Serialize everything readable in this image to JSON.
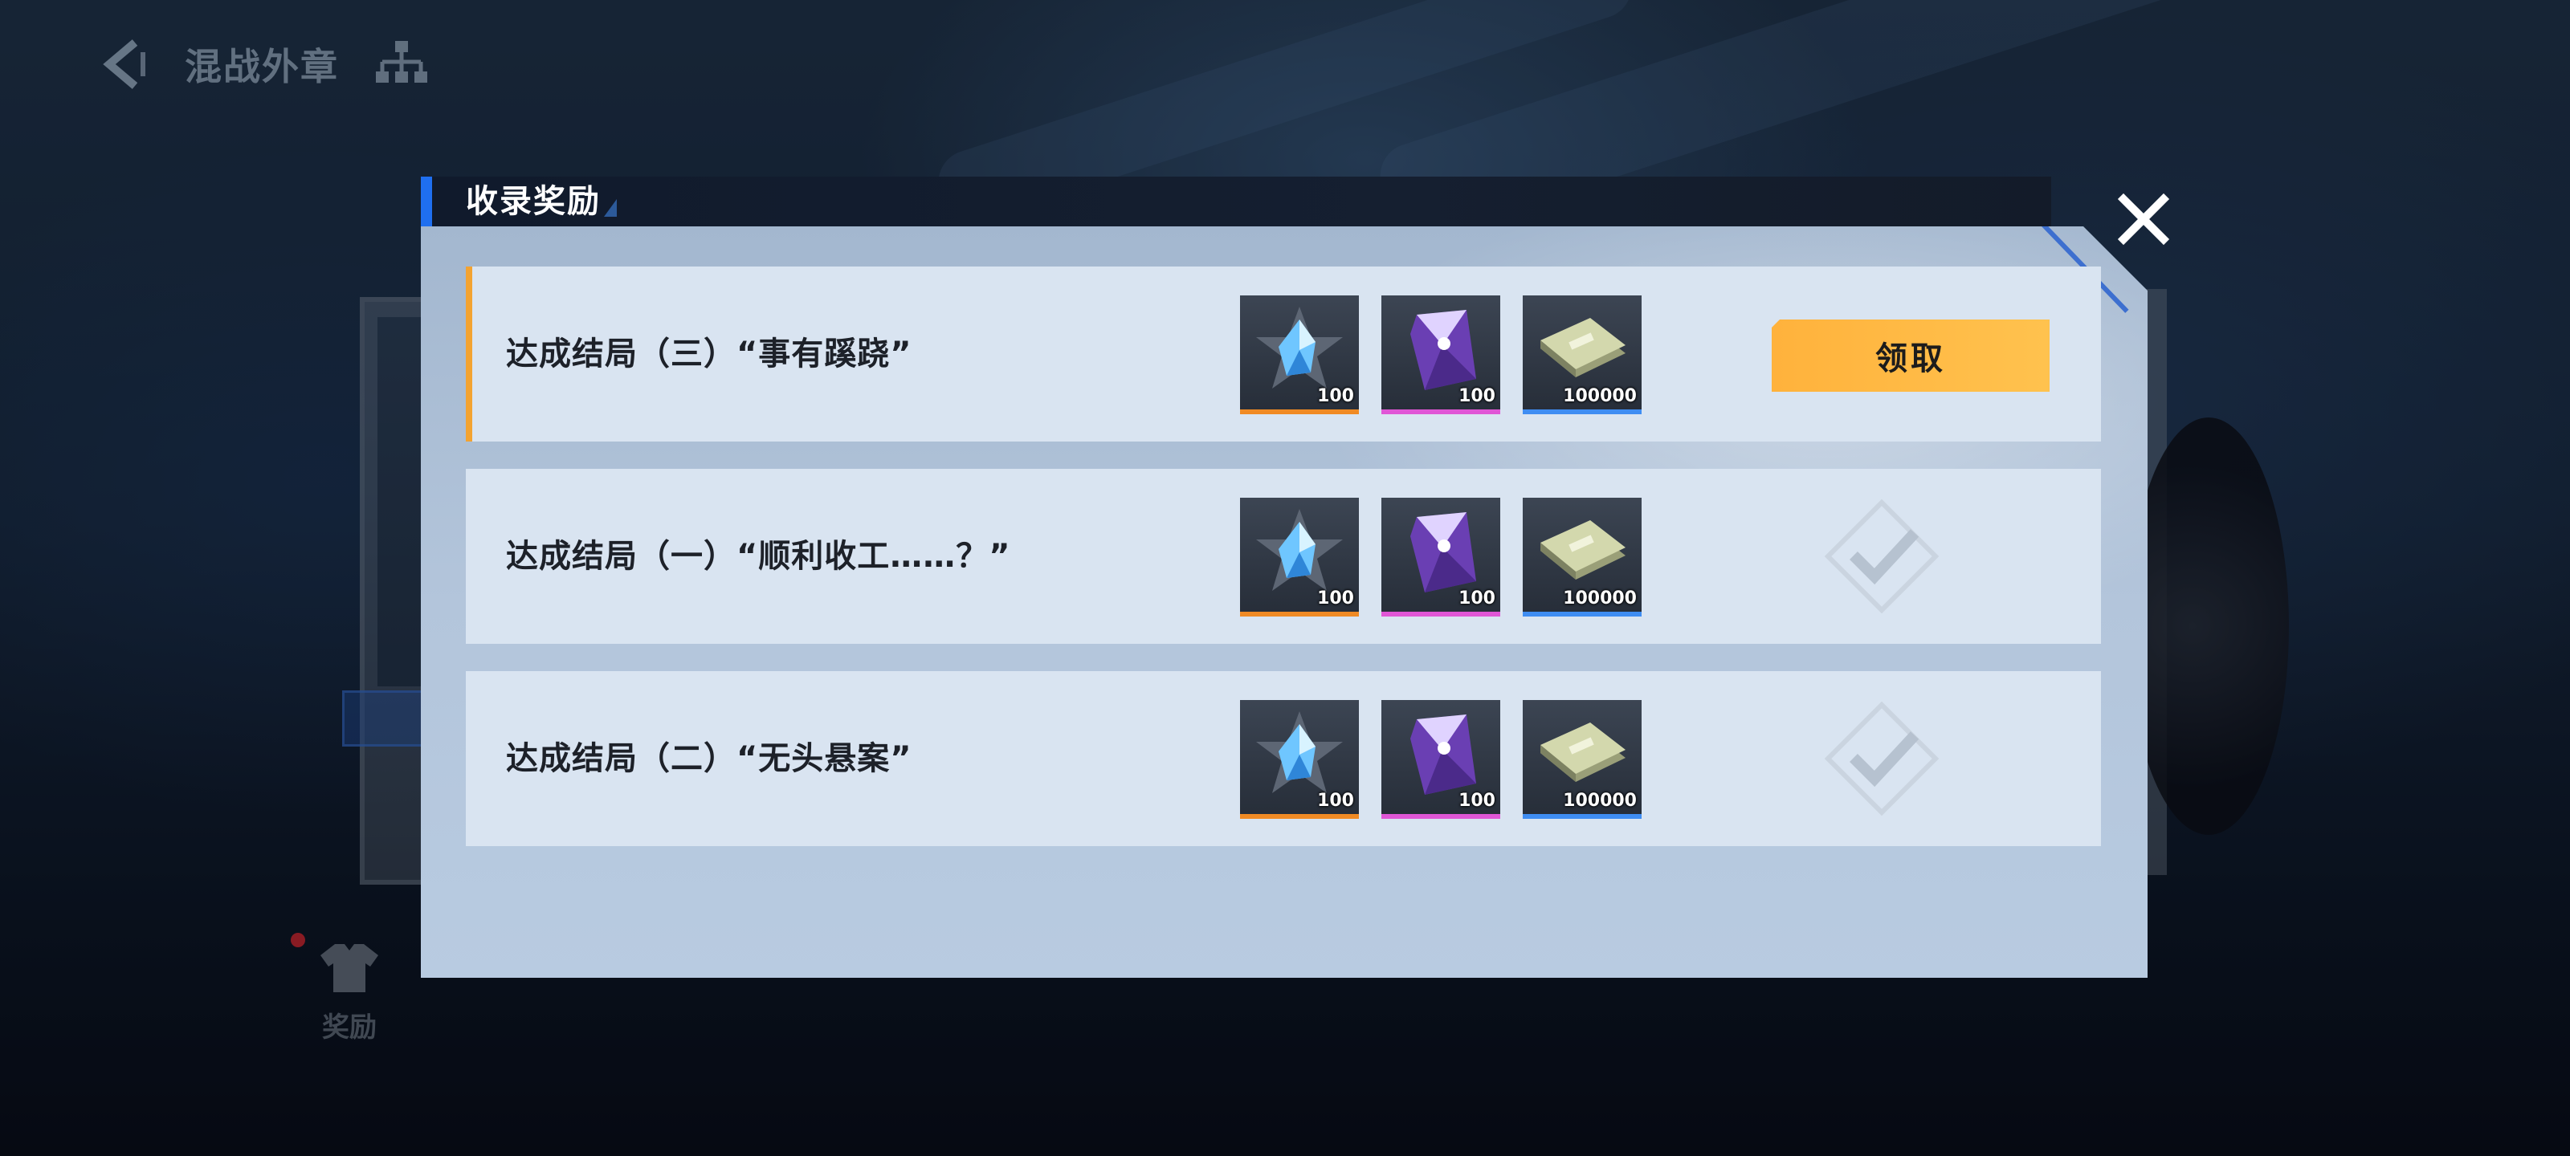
{
  "topbar": {
    "title": "混战外章"
  },
  "background": {
    "reward_shortcut_label": "奖励"
  },
  "modal": {
    "title": "收录奖励",
    "claim_label": "领取",
    "rows": [
      {
        "label": "达成结局（三）“事有蹊跷”",
        "status": "claimable",
        "items": [
          {
            "icon": "blue-crystal-star-icon",
            "qty": "100",
            "rarity_color": "#f08a24"
          },
          {
            "icon": "purple-prism-icon",
            "qty": "100",
            "rarity_color": "#e056d6"
          },
          {
            "icon": "cash-stack-icon",
            "qty": "100000",
            "rarity_color": "#3f8df2"
          }
        ]
      },
      {
        "label": "达成结局（一）“顺利收工……？”",
        "status": "claimed",
        "items": [
          {
            "icon": "blue-crystal-star-icon",
            "qty": "100",
            "rarity_color": "#f08a24"
          },
          {
            "icon": "purple-prism-icon",
            "qty": "100",
            "rarity_color": "#e056d6"
          },
          {
            "icon": "cash-stack-icon",
            "qty": "100000",
            "rarity_color": "#3f8df2"
          }
        ]
      },
      {
        "label": "达成结局（二）“无头悬案”",
        "status": "claimed",
        "items": [
          {
            "icon": "blue-crystal-star-icon",
            "qty": "100",
            "rarity_color": "#f08a24"
          },
          {
            "icon": "purple-prism-icon",
            "qty": "100",
            "rarity_color": "#e056d6"
          },
          {
            "icon": "cash-stack-icon",
            "qty": "100000",
            "rarity_color": "#3f8df2"
          }
        ]
      }
    ]
  }
}
